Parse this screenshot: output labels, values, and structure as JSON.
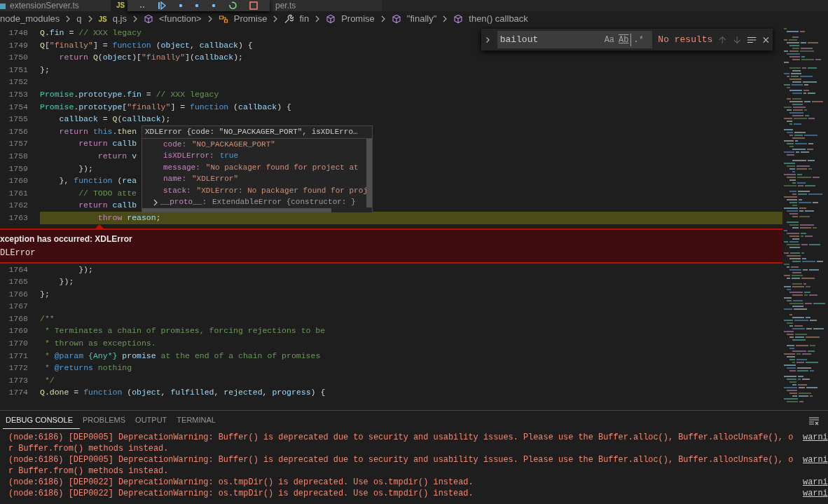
{
  "editor_tabs": [
    {
      "label": "extensionServer.ts",
      "selected": false
    },
    {
      "badge": "JS",
      "selected": true
    },
    {
      "label": "per.ts",
      "selected": false
    }
  ],
  "debug_toolbar": [
    {
      "kind": "drag"
    },
    {
      "kind": "continue"
    },
    {
      "kind": "step"
    },
    {
      "kind": "step"
    },
    {
      "kind": "step"
    },
    {
      "kind": "restart"
    },
    {
      "kind": "stop"
    }
  ],
  "breadcrumbs": [
    {
      "label": "node_modules",
      "kind": "folder"
    },
    {
      "label": "q",
      "kind": "folder"
    },
    {
      "label": "q.js",
      "kind": "file",
      "badge": "JS"
    },
    {
      "label": "<function>",
      "kind": "symbol"
    },
    {
      "label": "Promise",
      "kind": "class"
    },
    {
      "label": "fin",
      "kind": "property"
    },
    {
      "label": "Promise",
      "kind": "symbol"
    },
    {
      "label": "\"finally\"",
      "kind": "symbol"
    },
    {
      "label": "then() callback",
      "kind": "symbol"
    }
  ],
  "editor": {
    "lines_above": [
      {
        "number": "1748",
        "highlighted": false,
        "tokens": [
          {
            "kind": "function",
            "text": "Q"
          },
          {
            "kind": "plain",
            "text": "."
          },
          {
            "kind": "variable",
            "text": "fin"
          },
          {
            "kind": "plain",
            "text": " = "
          },
          {
            "kind": "comment",
            "text": "// XXX legacy"
          }
        ]
      },
      {
        "number": "1749",
        "highlighted": false,
        "tokens": [
          {
            "kind": "function",
            "text": "Q"
          },
          {
            "kind": "plain",
            "text": "["
          },
          {
            "kind": "string",
            "text": "\"finally\""
          },
          {
            "kind": "plain",
            "text": "] = "
          },
          {
            "kind": "storage",
            "text": "function"
          },
          {
            "kind": "plain",
            "text": " ("
          },
          {
            "kind": "variable",
            "text": "object"
          },
          {
            "kind": "plain",
            "text": ", "
          },
          {
            "kind": "variable",
            "text": "callback"
          },
          {
            "kind": "plain",
            "text": ") {"
          }
        ]
      },
      {
        "number": "1750",
        "highlighted": false,
        "tokens": [
          {
            "kind": "keyword",
            "text": "    return"
          },
          {
            "kind": "function",
            "text": " Q"
          },
          {
            "kind": "plain",
            "text": "("
          },
          {
            "kind": "variable",
            "text": "object"
          },
          {
            "kind": "plain",
            "text": ")["
          },
          {
            "kind": "string",
            "text": "\"finally\""
          },
          {
            "kind": "plain",
            "text": "]("
          },
          {
            "kind": "variable",
            "text": "callback"
          },
          {
            "kind": "plain",
            "text": ");"
          }
        ]
      },
      {
        "number": "1751",
        "highlighted": false,
        "tokens": [
          {
            "kind": "plain",
            "text": "};"
          }
        ]
      },
      {
        "number": "1752",
        "highlighted": false
      },
      {
        "number": "1753",
        "highlighted": false,
        "tokens": [
          {
            "kind": "type",
            "text": "Promise"
          },
          {
            "kind": "plain",
            "text": "."
          },
          {
            "kind": "variable",
            "text": "prototype"
          },
          {
            "kind": "plain",
            "text": "."
          },
          {
            "kind": "variable",
            "text": "fin"
          },
          {
            "kind": "plain",
            "text": " = "
          },
          {
            "kind": "comment",
            "text": "// XXX legacy"
          }
        ]
      },
      {
        "number": "1754",
        "highlighted": false,
        "tokens": [
          {
            "kind": "type",
            "text": "Promise"
          },
          {
            "kind": "plain",
            "text": "."
          },
          {
            "kind": "variable",
            "text": "prototype"
          },
          {
            "kind": "plain",
            "text": "["
          },
          {
            "kind": "string",
            "text": "\"finally\""
          },
          {
            "kind": "plain",
            "text": "] = "
          },
          {
            "kind": "storage",
            "text": "function"
          },
          {
            "kind": "plain",
            "text": " ("
          },
          {
            "kind": "variable",
            "text": "callback"
          },
          {
            "kind": "plain",
            "text": ") {"
          }
        ]
      },
      {
        "number": "1755",
        "highlighted": false,
        "tokens": [
          {
            "kind": "variable",
            "text": "    callback"
          },
          {
            "kind": "plain",
            "text": " = "
          },
          {
            "kind": "function",
            "text": "Q"
          },
          {
            "kind": "plain",
            "text": "("
          },
          {
            "kind": "variable",
            "text": "callback"
          },
          {
            "kind": "plain",
            "text": ");"
          }
        ]
      },
      {
        "number": "1756",
        "highlighted": false,
        "tokens": [
          {
            "kind": "keyword",
            "text": "    return"
          },
          {
            "kind": "storage",
            "text": " this"
          },
          {
            "kind": "plain",
            "text": "."
          },
          {
            "kind": "function",
            "text": "then"
          }
        ]
      },
      {
        "number": "1757",
        "highlighted": false,
        "tokens": [
          {
            "kind": "keyword",
            "text": "        return"
          },
          {
            "kind": "variable",
            "text": " callb"
          }
        ]
      },
      {
        "number": "1758",
        "highlighted": false,
        "tokens": [
          {
            "kind": "keyword",
            "text": "            return"
          },
          {
            "kind": "variable",
            "text": " v"
          }
        ]
      },
      {
        "number": "1759",
        "highlighted": false,
        "tokens": [
          {
            "kind": "plain",
            "text": "        });"
          }
        ]
      },
      {
        "number": "1760",
        "highlighted": false,
        "tokens": [
          {
            "kind": "plain",
            "text": "    }, "
          },
          {
            "kind": "storage",
            "text": "function"
          },
          {
            "kind": "plain",
            "text": " ("
          },
          {
            "kind": "variable",
            "text": "rea"
          }
        ]
      },
      {
        "number": "1761",
        "highlighted": false,
        "tokens": [
          {
            "kind": "comment",
            "text": "        // TODO atte"
          }
        ]
      },
      {
        "number": "1762",
        "highlighted": false,
        "tokens": [
          {
            "kind": "keyword",
            "text": "        return"
          },
          {
            "kind": "variable",
            "text": " callb"
          }
        ]
      },
      {
        "number": "1763",
        "highlighted": true,
        "tokens": [
          {
            "kind": "keyword",
            "text": "            throw"
          },
          {
            "kind": "variable",
            "text": " reason"
          },
          {
            "kind": "plain",
            "text": ";"
          }
        ]
      }
    ],
    "exception": {
      "title": "xception has occurred: XDLError",
      "detail": "DLError"
    },
    "lines_below": [
      {
        "number": "1764",
        "highlighted": false,
        "tokens": [
          {
            "kind": "plain",
            "text": "        });"
          }
        ]
      },
      {
        "number": "1765",
        "highlighted": false,
        "tokens": [
          {
            "kind": "plain",
            "text": "    });"
          }
        ]
      },
      {
        "number": "1766",
        "highlighted": false,
        "tokens": [
          {
            "kind": "plain",
            "text": "};"
          }
        ]
      },
      {
        "number": "1767",
        "highlighted": false
      },
      {
        "number": "1768",
        "highlighted": false,
        "tokens": [
          {
            "kind": "comment",
            "text": "/**"
          }
        ]
      },
      {
        "number": "1769",
        "highlighted": false,
        "tokens": [
          {
            "kind": "comment",
            "text": " * Terminates a chain of promises, forcing rejections to be"
          }
        ]
      },
      {
        "number": "1770",
        "highlighted": false,
        "tokens": [
          {
            "kind": "comment",
            "text": " * thrown as exceptions."
          }
        ]
      },
      {
        "number": "1771",
        "highlighted": false,
        "tokens": [
          {
            "kind": "comment",
            "text": " * "
          },
          {
            "kind": "storage",
            "text": "@param"
          },
          {
            "kind": "type",
            "text": " {Any*}"
          },
          {
            "kind": "variable",
            "text": " promise"
          },
          {
            "kind": "comment",
            "text": " at the end of a chain of promises"
          }
        ]
      },
      {
        "number": "1772",
        "highlighted": false,
        "tokens": [
          {
            "kind": "comment",
            "text": " * "
          },
          {
            "kind": "storage",
            "text": "@returns"
          },
          {
            "kind": "comment",
            "text": " nothing"
          }
        ]
      },
      {
        "number": "1773",
        "highlighted": false,
        "tokens": [
          {
            "kind": "comment",
            "text": " */"
          }
        ]
      },
      {
        "number": "1774",
        "highlighted": false,
        "tokens": [
          {
            "kind": "function",
            "text": "Q"
          },
          {
            "kind": "plain",
            "text": "."
          },
          {
            "kind": "function",
            "text": "done"
          },
          {
            "kind": "plain",
            "text": " = "
          },
          {
            "kind": "storage",
            "text": "function"
          },
          {
            "kind": "plain",
            "text": " ("
          },
          {
            "kind": "variable",
            "text": "object"
          },
          {
            "kind": "plain",
            "text": ", "
          },
          {
            "kind": "variable",
            "text": "fulfilled"
          },
          {
            "kind": "plain",
            "text": ", "
          },
          {
            "kind": "variable",
            "text": "rejected"
          },
          {
            "kind": "plain",
            "text": ", "
          },
          {
            "kind": "variable",
            "text": "progress"
          },
          {
            "kind": "plain",
            "text": ") {"
          }
        ]
      }
    ]
  },
  "hover": {
    "title": "XDLError {code: \"NO_PACKAGER_PORT\", isXDLErro…",
    "properties": [
      {
        "key": "code:",
        "value": "\"NO_PACKAGER_PORT\"",
        "kind": "string"
      },
      {
        "key": "isXDLError:",
        "value": "true",
        "kind": "boolean"
      },
      {
        "key": "message:",
        "value": "\"No packager found for project at",
        "kind": "string"
      },
      {
        "key": "name:",
        "value": "\"XDLError\"",
        "kind": "string"
      },
      {
        "key": "stack:",
        "value": "\"XDLError: No packager found for proj",
        "kind": "string"
      },
      {
        "key": "__proto__:",
        "value": "ExtendableError {constructor: }",
        "kind": "object",
        "expanded": false
      }
    ]
  },
  "find": {
    "query": "bailout",
    "options": [
      {
        "label": "Aa",
        "kind": "case"
      },
      {
        "label": "Ab",
        "kind": "word"
      },
      {
        "label": ".*",
        "kind": "regex"
      }
    ],
    "result": "No results",
    "navigation": [
      {
        "kind": "previous",
        "disabled": true
      },
      {
        "kind": "next",
        "disabled": true
      }
    ]
  },
  "panel": {
    "tabs": [
      {
        "label": "DEBUG CONSOLE",
        "selected": true
      },
      {
        "label": "PROBLEMS",
        "selected": false
      },
      {
        "label": "OUTPUT",
        "selected": false
      },
      {
        "label": "TERMINAL",
        "selected": false
      }
    ],
    "messages": [
      {
        "lines": [
          "(node:6186) [DEP0005] DeprecationWarning: Buffer() is deprecated due to security and usability issues. Please use the Buffer.alloc(), Buffer.allocUnsafe(), o",
          "r Buffer.from() methods instead."
        ],
        "source": "warni"
      },
      {
        "lines": [
          "(node:6186) [DEP0005] DeprecationWarning: Buffer() is deprecated due to security and usability issues. Please use the Buffer.alloc(), Buffer.allocUnsafe(), o",
          "r Buffer.from() methods instead."
        ],
        "source": "warni"
      },
      {
        "lines": [
          "(node:6186) [DEP0022] DeprecationWarning: os.tmpDir() is deprecated. Use os.tmpdir() instead."
        ],
        "source": "warni"
      },
      {
        "lines": [
          "(node:6186) [DEP0022] DeprecationWarning: os.tmpDir() is deprecated. Use os.tmpdir() instead."
        ],
        "source": "warni"
      }
    ]
  }
}
